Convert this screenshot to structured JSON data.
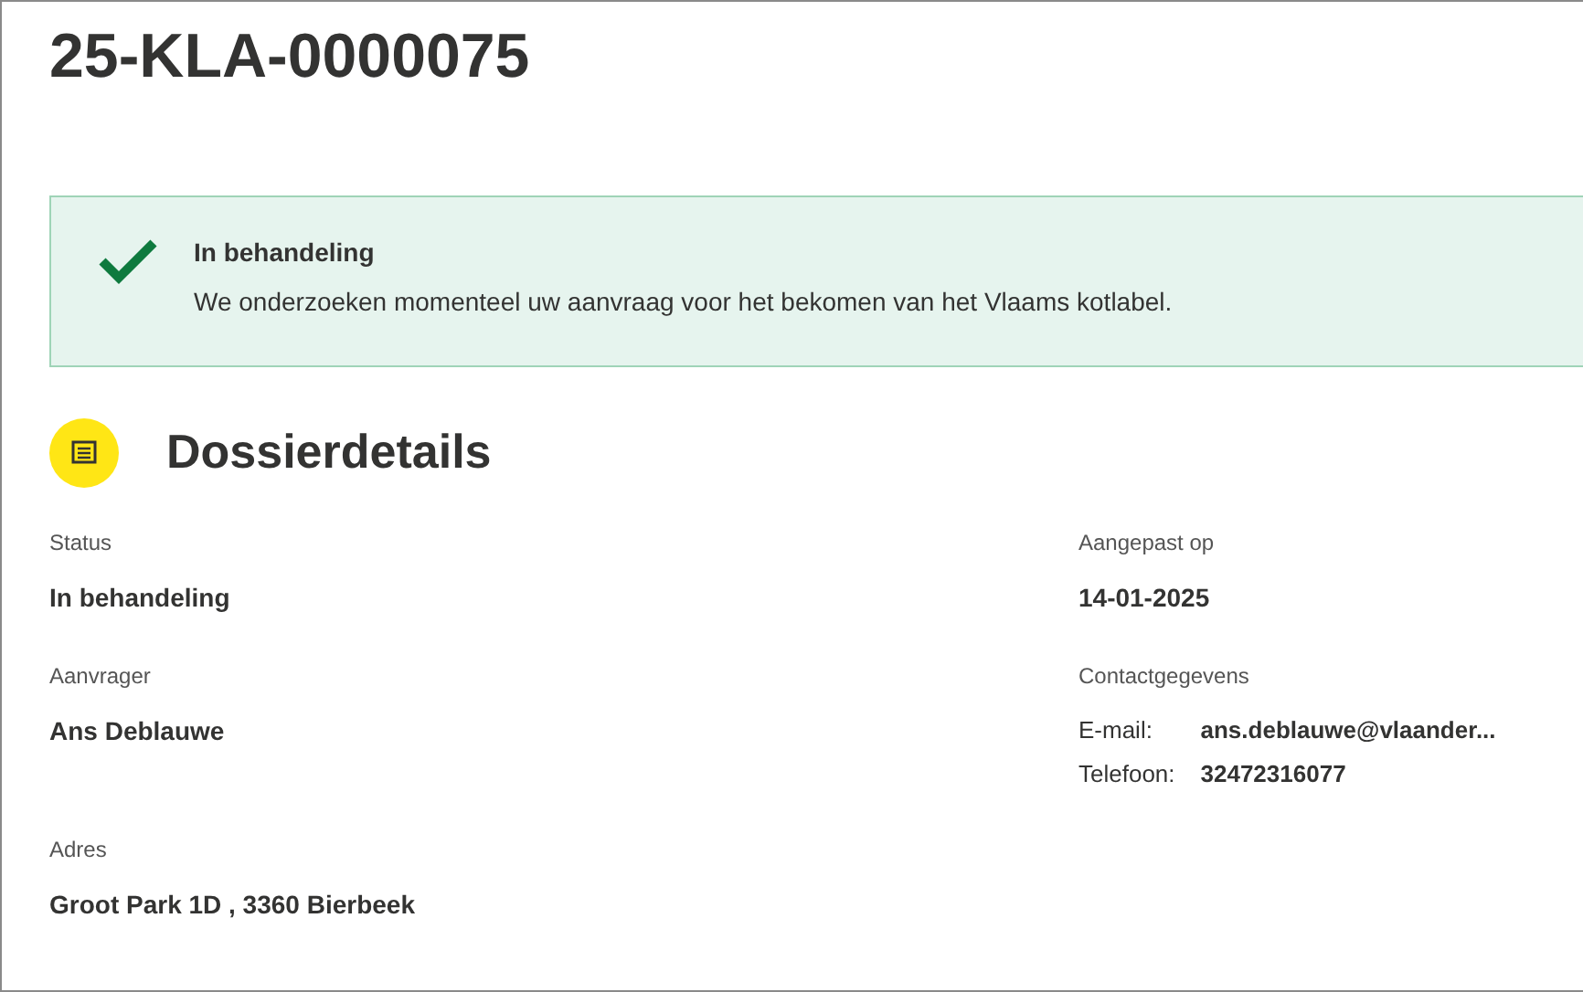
{
  "title": "25-KLA-0000075",
  "alert": {
    "title": "In behandeling",
    "message": "We onderzoeken momenteel uw aanvraag voor het bekomen van het Vlaams kotlabel."
  },
  "section": {
    "title": "Dossierdetails"
  },
  "fields": [
    {
      "label": "Status",
      "value": "In behandeling"
    },
    {
      "label": "Aangepast op",
      "value": "14-01-2025"
    },
    {
      "label": "Aanvrager",
      "value": "Ans Deblauwe"
    },
    {
      "label": "Contactgegevens",
      "contacts": [
        {
          "label": "E-mail:",
          "value": "ans.deblauwe@vlaander..."
        },
        {
          "label": "Telefoon:",
          "value": "32472316077"
        }
      ]
    },
    {
      "label": "Adres",
      "value": "Groot Park 1D , 3360 Bierbeek"
    }
  ]
}
